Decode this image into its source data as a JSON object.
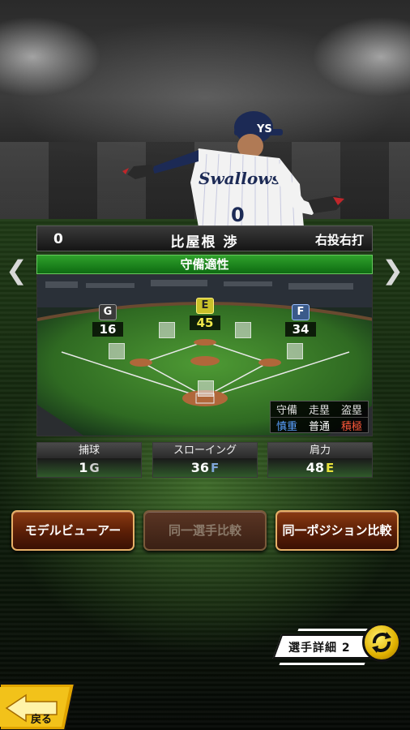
{
  "player": {
    "number": "0",
    "name": "比屋根 渉",
    "throw_bat": "右投右打"
  },
  "nav": {
    "prev_icon": "chevron-left-icon",
    "next_icon": "chevron-right-icon"
  },
  "field": {
    "title": "守備適性",
    "positions": [
      {
        "key": "left",
        "grade": "G",
        "value": "16",
        "grade_color": "#c9c9c9"
      },
      {
        "key": "center",
        "grade": "E",
        "value": "45",
        "grade_color": "#e8e23a"
      },
      {
        "key": "right",
        "grade": "F",
        "value": "34",
        "grade_color": "#7fa6d8"
      }
    ],
    "style": {
      "headers": [
        "守備",
        "走塁",
        "盗塁"
      ],
      "values": [
        "慎重",
        "普通",
        "積極"
      ],
      "value_colors": [
        "#5aa0ff",
        "#ffffff",
        "#ff5a3a"
      ]
    }
  },
  "stats": [
    {
      "label": "捕球",
      "value": "1",
      "grade": "G",
      "grade_color": "#cfcfcf"
    },
    {
      "label": "スローイング",
      "value": "36",
      "grade": "F",
      "grade_color": "#7fa6d8"
    },
    {
      "label": "肩力",
      "value": "48",
      "grade": "E",
      "grade_color": "#e8e23a"
    }
  ],
  "buttons": {
    "model_viewer": "モデルビューアー",
    "same_player_compare": "同一選手比較",
    "same_position_compare": "同一ポジション比較"
  },
  "detail": {
    "label": "選手詳細 2"
  },
  "back": {
    "label": "戻る"
  }
}
